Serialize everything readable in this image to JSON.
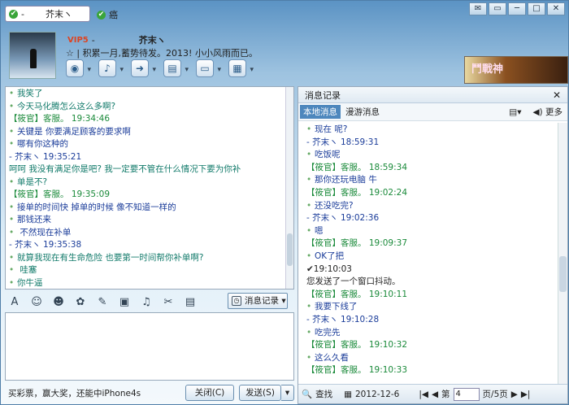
{
  "top": {
    "tab1_name": "-",
    "tab1_sub": "芥末ヽ",
    "tab2_name": "癌",
    "buttons": [
      "✉",
      "▭",
      "─",
      "□",
      "✕"
    ]
  },
  "header": {
    "vip": "VIP5",
    "dash": "-",
    "name": "芥末ヽ",
    "signature": "积累一月,蓄势待发。2013! 小小风雨而已。",
    "game_banner": "鬥戰神"
  },
  "toolbar_icons": [
    "camera-icon",
    "mic-icon",
    "transfer-icon",
    "app-icon",
    "screen-icon",
    "more-icon"
  ],
  "chat_lines": [
    {
      "text": "我笑了",
      "cls": "teal",
      "indent": 1
    },
    {
      "text": "今天马化腾怎么这么多啊?",
      "cls": "teal",
      "indent": 1
    },
    {
      "text": "【筱官】客服。      19:34:46",
      "cls": "green",
      "indent": 0
    },
    {
      "text": "关键是   你要满足顾客的要求啊",
      "cls": "blue",
      "indent": 1
    },
    {
      "text": "哪有你这种的",
      "cls": "blue",
      "indent": 1
    },
    {
      "text": "-         芥末ヽ     19:35:21",
      "cls": "blue",
      "indent": 0
    },
    {
      "text": "   呵呵  我没有满足你是吧?  我一定要不管在什么情况下要为你补",
      "cls": "teal",
      "indent": 0
    },
    {
      "text": "单是不?",
      "cls": "teal",
      "indent": 1
    },
    {
      "text": "【筱官】客服。      19:35:09",
      "cls": "green",
      "indent": 0
    },
    {
      "text": "接单的时间快  掉单的时候  像不知道一样的",
      "cls": "blue",
      "indent": 1
    },
    {
      "text": "那钱还来",
      "cls": "blue",
      "indent": 1
    },
    {
      "text": "  不然现在补单",
      "cls": "blue",
      "indent": 1
    },
    {
      "text": "-         芥末ヽ     19:35:38",
      "cls": "blue",
      "indent": 0
    },
    {
      "text": "就算我现在有生命危险  也要第一时间帮你补单啊?",
      "cls": "teal",
      "indent": 1
    },
    {
      "text": "  哇塞",
      "cls": "teal",
      "indent": 1
    },
    {
      "text": "你牛逼",
      "cls": "teal",
      "indent": 1
    }
  ],
  "format_icons": [
    "font-icon",
    "emoji-icon",
    "face-icon",
    "magic-icon",
    "edit-icon",
    "image-icon",
    "music-icon",
    "scissors-icon",
    "app-icon"
  ],
  "history_button": "消息记录",
  "bottom": {
    "ad": "买彩票，赢大奖，还能中iPhone4s",
    "close": "关闭(C)",
    "send": "发送(S)"
  },
  "history": {
    "title": "消息记录",
    "tab_local": "本地消息",
    "tab_roam": "漫游消息",
    "more": "更多",
    "lines": [
      {
        "text": "现在  呢?",
        "cls": "blue",
        "indent": 1
      },
      {
        "text": "-        芥末ヽ    18:59:31",
        "cls": "blue",
        "indent": 0
      },
      {
        "text": "吃饭呢",
        "cls": "blue",
        "indent": 1
      },
      {
        "text": "【筱官】客服。     18:59:34",
        "cls": "green",
        "indent": 0
      },
      {
        "text": "那你还玩电脑  牛",
        "cls": "blue",
        "indent": 1
      },
      {
        "text": "【筱官】客服。     19:02:24",
        "cls": "green",
        "indent": 0
      },
      {
        "text": "还没吃完?",
        "cls": "blue",
        "indent": 1
      },
      {
        "text": "-        芥末ヽ    19:02:36",
        "cls": "blue",
        "indent": 0
      },
      {
        "text": "嗯",
        "cls": "blue",
        "indent": 1
      },
      {
        "text": "【筱官】客服。     19:09:37",
        "cls": "green",
        "indent": 0
      },
      {
        "text": "OK了把",
        "cls": "blue",
        "indent": 1
      },
      {
        "text": "✔19:10:03",
        "cls": "",
        "indent": 0
      },
      {
        "text": "您发送了一个窗口抖动。",
        "cls": "",
        "indent": 0
      },
      {
        "text": "【筱官】客服。     19:10:11",
        "cls": "green",
        "indent": 0
      },
      {
        "text": "我要下线了",
        "cls": "blue",
        "indent": 1
      },
      {
        "text": "-        芥末ヽ    19:10:28",
        "cls": "blue",
        "indent": 0
      },
      {
        "text": "吃完先",
        "cls": "blue",
        "indent": 1
      },
      {
        "text": "【筱官】客服。     19:10:32",
        "cls": "green",
        "indent": 0
      },
      {
        "text": "这么久看",
        "cls": "blue",
        "indent": 1
      },
      {
        "text": "【筱官】客服。     19:10:33",
        "cls": "green",
        "indent": 0
      }
    ],
    "search": "查找",
    "date": "2012-12-6",
    "page_label": "第",
    "page_value": "4",
    "page_total": "页/5页"
  }
}
